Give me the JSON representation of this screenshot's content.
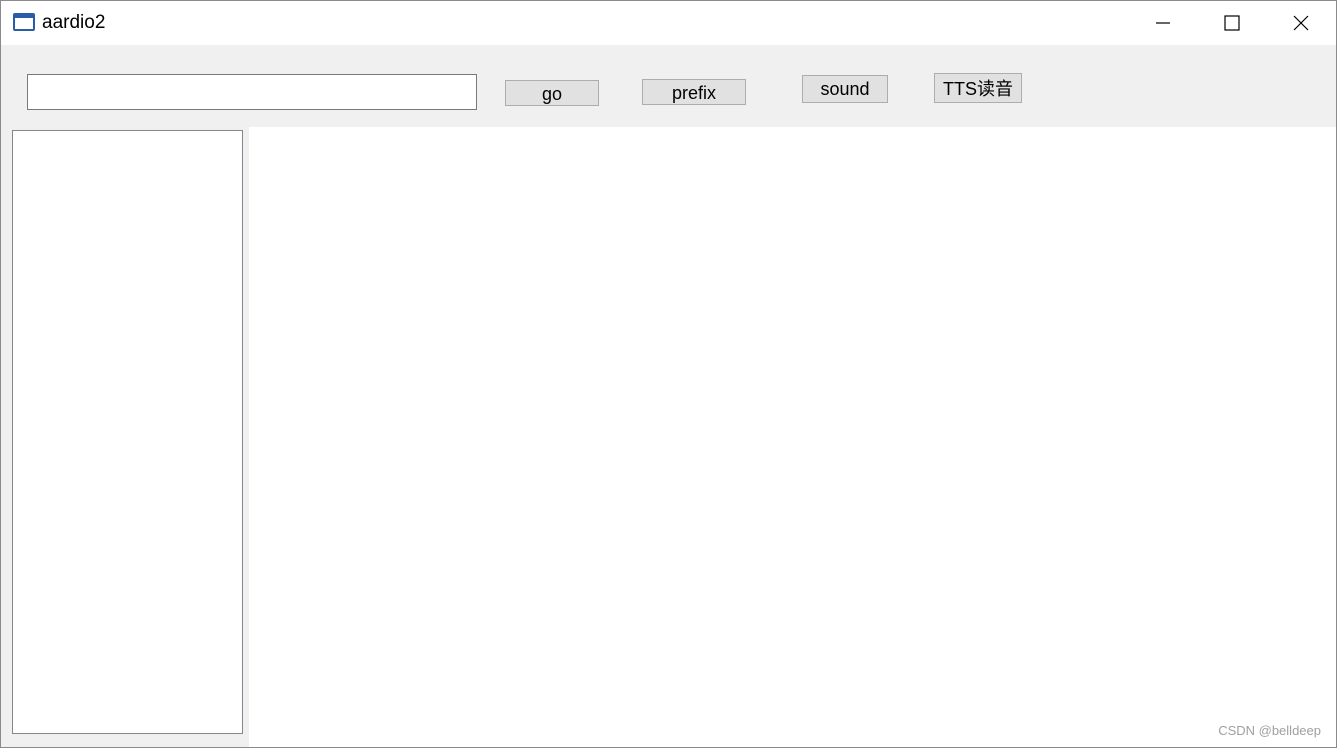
{
  "window": {
    "title": "aardio2",
    "icon": "app-window-icon"
  },
  "titlebar_controls": {
    "minimize_icon": "minimize-icon",
    "maximize_icon": "maximize-icon",
    "close_icon": "close-icon"
  },
  "toolbar": {
    "search_value": "",
    "search_placeholder": "",
    "go_label": "go",
    "prefix_label": "prefix",
    "sound_label": "sound",
    "tts_label": "TTS读音"
  },
  "watermark": "CSDN @belldeep",
  "colors": {
    "toolbar_bg": "#f0f0f0",
    "button_bg": "#e1e1e1",
    "icon_blue": "#2a5caa"
  }
}
